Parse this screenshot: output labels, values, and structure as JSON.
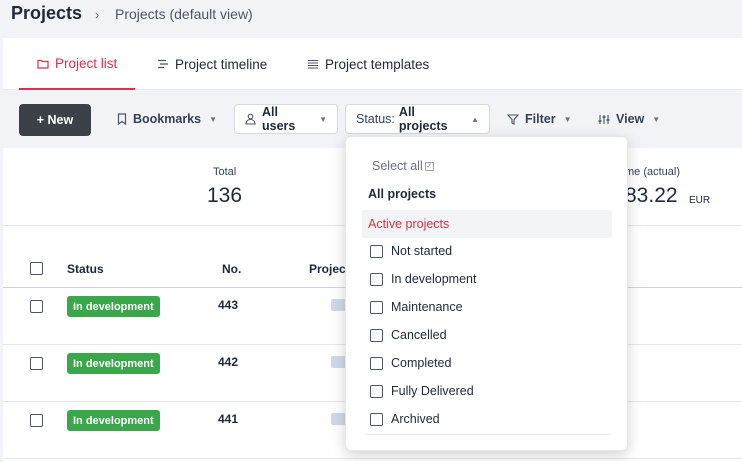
{
  "header": {
    "title": "Projects",
    "breadcrumb": "Projects (default view)"
  },
  "tabs": [
    {
      "label": "Project list",
      "icon": "folder-icon",
      "active": true
    },
    {
      "label": "Project timeline",
      "icon": "timeline-icon",
      "active": false
    },
    {
      "label": "Project templates",
      "icon": "list-icon",
      "active": false
    }
  ],
  "toolbar": {
    "new_label": "+ New",
    "bookmarks_label": "Bookmarks",
    "users_label": "All users",
    "status_prefix": "Status:",
    "status_value": "All projects",
    "filter_label": "Filter",
    "view_label": "View"
  },
  "stats": {
    "total_label": "Total",
    "total_value": "136",
    "time_label": "me (actual)",
    "time_value": "83.22",
    "time_unit": "EUR"
  },
  "table": {
    "headers": {
      "status": "Status",
      "no": "No.",
      "project": "Projec"
    },
    "rows": [
      {
        "status": "In development",
        "no": "443"
      },
      {
        "status": "In development",
        "no": "442"
      },
      {
        "status": "In development",
        "no": "441"
      }
    ]
  },
  "status_dropdown": {
    "select_all": "Select all",
    "group_label": "All projects",
    "active_option": "Active projects",
    "options": [
      "Not started",
      "In development",
      "Maintenance",
      "Cancelled",
      "Completed",
      "Fully Delivered",
      "Archived"
    ]
  },
  "colors": {
    "accent": "#d6334a",
    "badge_green": "#3aa84a",
    "new_button": "#3c4147"
  }
}
